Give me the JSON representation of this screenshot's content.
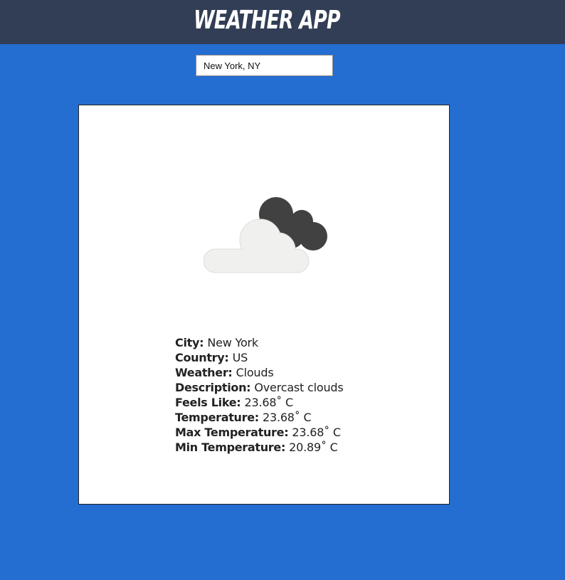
{
  "header": {
    "title": "WEATHER APP",
    "background": "#323e55"
  },
  "search": {
    "value": "New York, NY"
  },
  "page": {
    "background": "#246dd1"
  },
  "card": {
    "icon": "overcast-clouds-icon",
    "details": [
      {
        "label": "City:",
        "value": "New York"
      },
      {
        "label": "Country:",
        "value": "US"
      },
      {
        "label": "Weather:",
        "value": "Clouds"
      },
      {
        "label": "Description:",
        "value": "Overcast clouds"
      },
      {
        "label": "Feels Like:",
        "value": "23.68˚ C"
      },
      {
        "label": "Temperature:",
        "value": "23.68˚ C"
      },
      {
        "label": "Max Temperature:",
        "value": "23.68˚ C"
      },
      {
        "label": "Min Temperature:",
        "value": "20.89˚ C"
      }
    ]
  }
}
